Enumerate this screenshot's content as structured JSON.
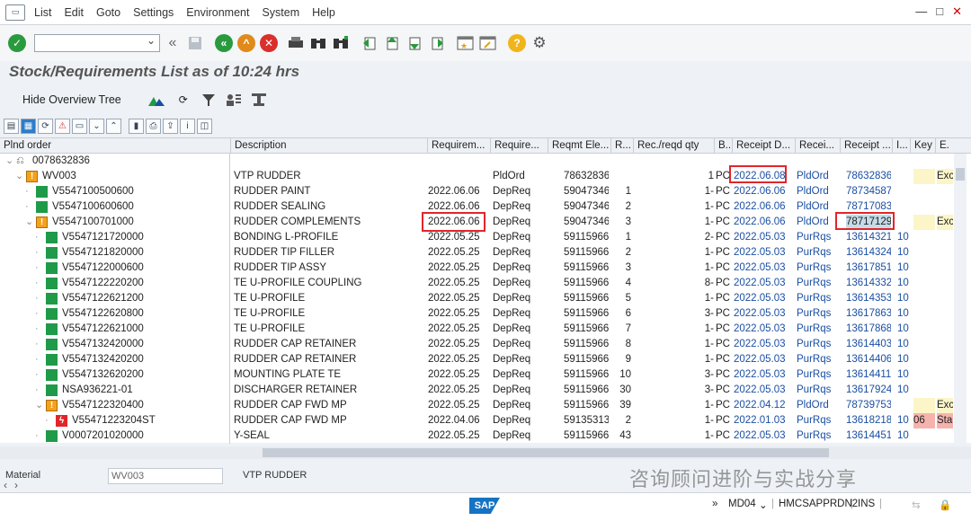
{
  "menu": [
    "List",
    "Edit",
    "Goto",
    "Settings",
    "Environment",
    "System",
    "Help"
  ],
  "window_controls": [
    "—",
    "□",
    "✕"
  ],
  "toolbar": {
    "command_value": ""
  },
  "title": "Stock/Requirements List as of 10:24 hrs",
  "app_toolbar": {
    "hide_tree": "Hide Overview Tree"
  },
  "columns": [
    "Plnd order",
    "Description",
    "Requirem...",
    "Require...",
    "Reqmt Ele...",
    "R...",
    "Rec./reqd qty",
    "B...",
    "Receipt D...",
    "Recei...",
    "Receipt ...",
    "I...",
    "Key",
    "E."
  ],
  "rows": [
    {
      "tree": "0078632836",
      "level": 0,
      "icon": "link",
      "desc": "",
      "reqdate": "",
      "elem": "",
      "elemno": "",
      "r": "",
      "qty": "",
      "unit": "",
      "recdate": "",
      "recel": "",
      "recno": "",
      "i": "",
      "key": "",
      "e": ""
    },
    {
      "tree": "WV003",
      "level": 1,
      "icon": "warn",
      "desc": "VTP RUDDER",
      "reqdate": "",
      "elem": "PldOrd",
      "elemno": "78632836",
      "r": "",
      "qty": "1",
      "unit": "PC",
      "recdate": "2022.06.08",
      "recel": "PldOrd",
      "recno": "78632836",
      "i": "",
      "key": "",
      "e": "Exc",
      "hl": "yellow"
    },
    {
      "tree": "V5547100500600",
      "level": 2,
      "icon": "green",
      "desc": "RUDDER PAINT",
      "reqdate": "2022.06.06",
      "elem": "DepReq",
      "elemno": "59047346",
      "r": "1",
      "qty": "1-",
      "unit": "PC",
      "recdate": "2022.06.06",
      "recel": "PldOrd",
      "recno": "78734587",
      "i": "",
      "key": "",
      "e": ""
    },
    {
      "tree": "V5547100600600",
      "level": 2,
      "icon": "green",
      "desc": "RUDDER SEALING",
      "reqdate": "2022.06.06",
      "elem": "DepReq",
      "elemno": "59047346",
      "r": "2",
      "qty": "1-",
      "unit": "PC",
      "recdate": "2022.06.06",
      "recel": "PldOrd",
      "recno": "78717083",
      "i": "",
      "key": "",
      "e": ""
    },
    {
      "tree": "V5547100701000",
      "level": 2,
      "icon": "warn",
      "desc": "RUDDER COMPLEMENTS",
      "reqdate": "2022.06.06",
      "elem": "DepReq",
      "elemno": "59047346",
      "r": "3",
      "qty": "1-",
      "unit": "PC",
      "recdate": "2022.06.06",
      "recel": "PldOrd",
      "recno": "78717129",
      "i": "",
      "key": "",
      "e": "Exc",
      "hl": "yellow"
    },
    {
      "tree": "V5547121720000",
      "level": 3,
      "icon": "green",
      "desc": "BONDING L-PROFILE",
      "reqdate": "2022.05.25",
      "elem": "DepReq",
      "elemno": "59115966",
      "r": "1",
      "qty": "2-",
      "unit": "PC",
      "recdate": "2022.05.03",
      "recel": "PurRqs",
      "recno": "13614321",
      "i": "10",
      "key": "",
      "e": ""
    },
    {
      "tree": "V5547121820000",
      "level": 3,
      "icon": "green",
      "desc": "RUDDER TIP FILLER",
      "reqdate": "2022.05.25",
      "elem": "DepReq",
      "elemno": "59115966",
      "r": "2",
      "qty": "1-",
      "unit": "PC",
      "recdate": "2022.05.03",
      "recel": "PurRqs",
      "recno": "13614324",
      "i": "10",
      "key": "",
      "e": ""
    },
    {
      "tree": "V5547122000600",
      "level": 3,
      "icon": "green",
      "desc": "RUDDER TIP ASSY",
      "reqdate": "2022.05.25",
      "elem": "DepReq",
      "elemno": "59115966",
      "r": "3",
      "qty": "1-",
      "unit": "PC",
      "recdate": "2022.05.03",
      "recel": "PurRqs",
      "recno": "13617851",
      "i": "10",
      "key": "",
      "e": ""
    },
    {
      "tree": "V5547122220200",
      "level": 3,
      "icon": "green",
      "desc": "TE U-PROFILE COUPLING",
      "reqdate": "2022.05.25",
      "elem": "DepReq",
      "elemno": "59115966",
      "r": "4",
      "qty": "8-",
      "unit": "PC",
      "recdate": "2022.05.03",
      "recel": "PurRqs",
      "recno": "13614332",
      "i": "10",
      "key": "",
      "e": ""
    },
    {
      "tree": "V5547122621200",
      "level": 3,
      "icon": "green",
      "desc": "TE U-PROFILE",
      "reqdate": "2022.05.25",
      "elem": "DepReq",
      "elemno": "59115966",
      "r": "5",
      "qty": "1-",
      "unit": "PC",
      "recdate": "2022.05.03",
      "recel": "PurRqs",
      "recno": "13614353",
      "i": "10",
      "key": "",
      "e": ""
    },
    {
      "tree": "V5547122620800",
      "level": 3,
      "icon": "green",
      "desc": "TE U-PROFILE",
      "reqdate": "2022.05.25",
      "elem": "DepReq",
      "elemno": "59115966",
      "r": "6",
      "qty": "3-",
      "unit": "PC",
      "recdate": "2022.05.03",
      "recel": "PurRqs",
      "recno": "13617863",
      "i": "10",
      "key": "",
      "e": ""
    },
    {
      "tree": "V5547122621000",
      "level": 3,
      "icon": "green",
      "desc": "TE U-PROFILE",
      "reqdate": "2022.05.25",
      "elem": "DepReq",
      "elemno": "59115966",
      "r": "7",
      "qty": "1-",
      "unit": "PC",
      "recdate": "2022.05.03",
      "recel": "PurRqs",
      "recno": "13617868",
      "i": "10",
      "key": "",
      "e": ""
    },
    {
      "tree": "V5547132420000",
      "level": 3,
      "icon": "green",
      "desc": "RUDDER CAP RETAINER",
      "reqdate": "2022.05.25",
      "elem": "DepReq",
      "elemno": "59115966",
      "r": "8",
      "qty": "1-",
      "unit": "PC",
      "recdate": "2022.05.03",
      "recel": "PurRqs",
      "recno": "13614403",
      "i": "10",
      "key": "",
      "e": ""
    },
    {
      "tree": "V5547132420200",
      "level": 3,
      "icon": "green",
      "desc": "RUDDER CAP RETAINER",
      "reqdate": "2022.05.25",
      "elem": "DepReq",
      "elemno": "59115966",
      "r": "9",
      "qty": "1-",
      "unit": "PC",
      "recdate": "2022.05.03",
      "recel": "PurRqs",
      "recno": "13614406",
      "i": "10",
      "key": "",
      "e": ""
    },
    {
      "tree": "V5547132620200",
      "level": 3,
      "icon": "green",
      "desc": "MOUNTING PLATE TE",
      "reqdate": "2022.05.25",
      "elem": "DepReq",
      "elemno": "59115966",
      "r": "10",
      "qty": "3-",
      "unit": "PC",
      "recdate": "2022.05.03",
      "recel": "PurRqs",
      "recno": "13614411",
      "i": "10",
      "key": "",
      "e": ""
    },
    {
      "tree": "NSA936221-01",
      "level": 3,
      "icon": "green",
      "desc": "DISCHARGER RETAINER",
      "reqdate": "2022.05.25",
      "elem": "DepReq",
      "elemno": "59115966",
      "r": "30",
      "qty": "3-",
      "unit": "PC",
      "recdate": "2022.05.03",
      "recel": "PurRqs",
      "recno": "13617924",
      "i": "10",
      "key": "",
      "e": ""
    },
    {
      "tree": "V5547122320400",
      "level": 3,
      "icon": "warn",
      "desc": "RUDDER CAP FWD MP",
      "reqdate": "2022.05.25",
      "elem": "DepReq",
      "elemno": "59115966",
      "r": "39",
      "qty": "1-",
      "unit": "PC",
      "recdate": "2022.04.12",
      "recel": "PldOrd",
      "recno": "78739753",
      "i": "",
      "key": "",
      "e": "Exc",
      "hl": "yellow"
    },
    {
      "tree": "V55471223204ST",
      "level": 4,
      "icon": "err",
      "desc": "RUDDER CAP FWD MP",
      "reqdate": "2022.04.06",
      "elem": "DepReq",
      "elemno": "59135313",
      "r": "2",
      "qty": "1-",
      "unit": "PC",
      "recdate": "2022.01.03",
      "recel": "PurRqs",
      "recno": "13618218",
      "i": "10",
      "key": "06",
      "e": "Sta",
      "hl": "pink"
    },
    {
      "tree": "V0007201020000",
      "level": 3,
      "icon": "green",
      "desc": "Y-SEAL",
      "reqdate": "2022.05.25",
      "elem": "DepReq",
      "elemno": "59115966",
      "r": "43",
      "qty": "1-",
      "unit": "PC",
      "recdate": "2022.05.03",
      "recel": "PurRqs",
      "recno": "13614451",
      "i": "10",
      "key": "",
      "e": ""
    }
  ],
  "lower": {
    "label": "Material",
    "value": "WV003",
    "desc": "VTP RUDDER"
  },
  "status": {
    "tcode": "MD04",
    "system": "HMCSAPPRDN2",
    "mode": "INS"
  },
  "watermark": "咨询顾问进阶与实战分享",
  "colors": {
    "green": "#1f9a48",
    "warn": "#f4a11d",
    "error": "#e0262b",
    "link": "#1a4ea3",
    "highlight_yellow": "#fbf5c8",
    "highlight_pink": "#f6b3ad",
    "annotation_red": "#e0262b"
  }
}
